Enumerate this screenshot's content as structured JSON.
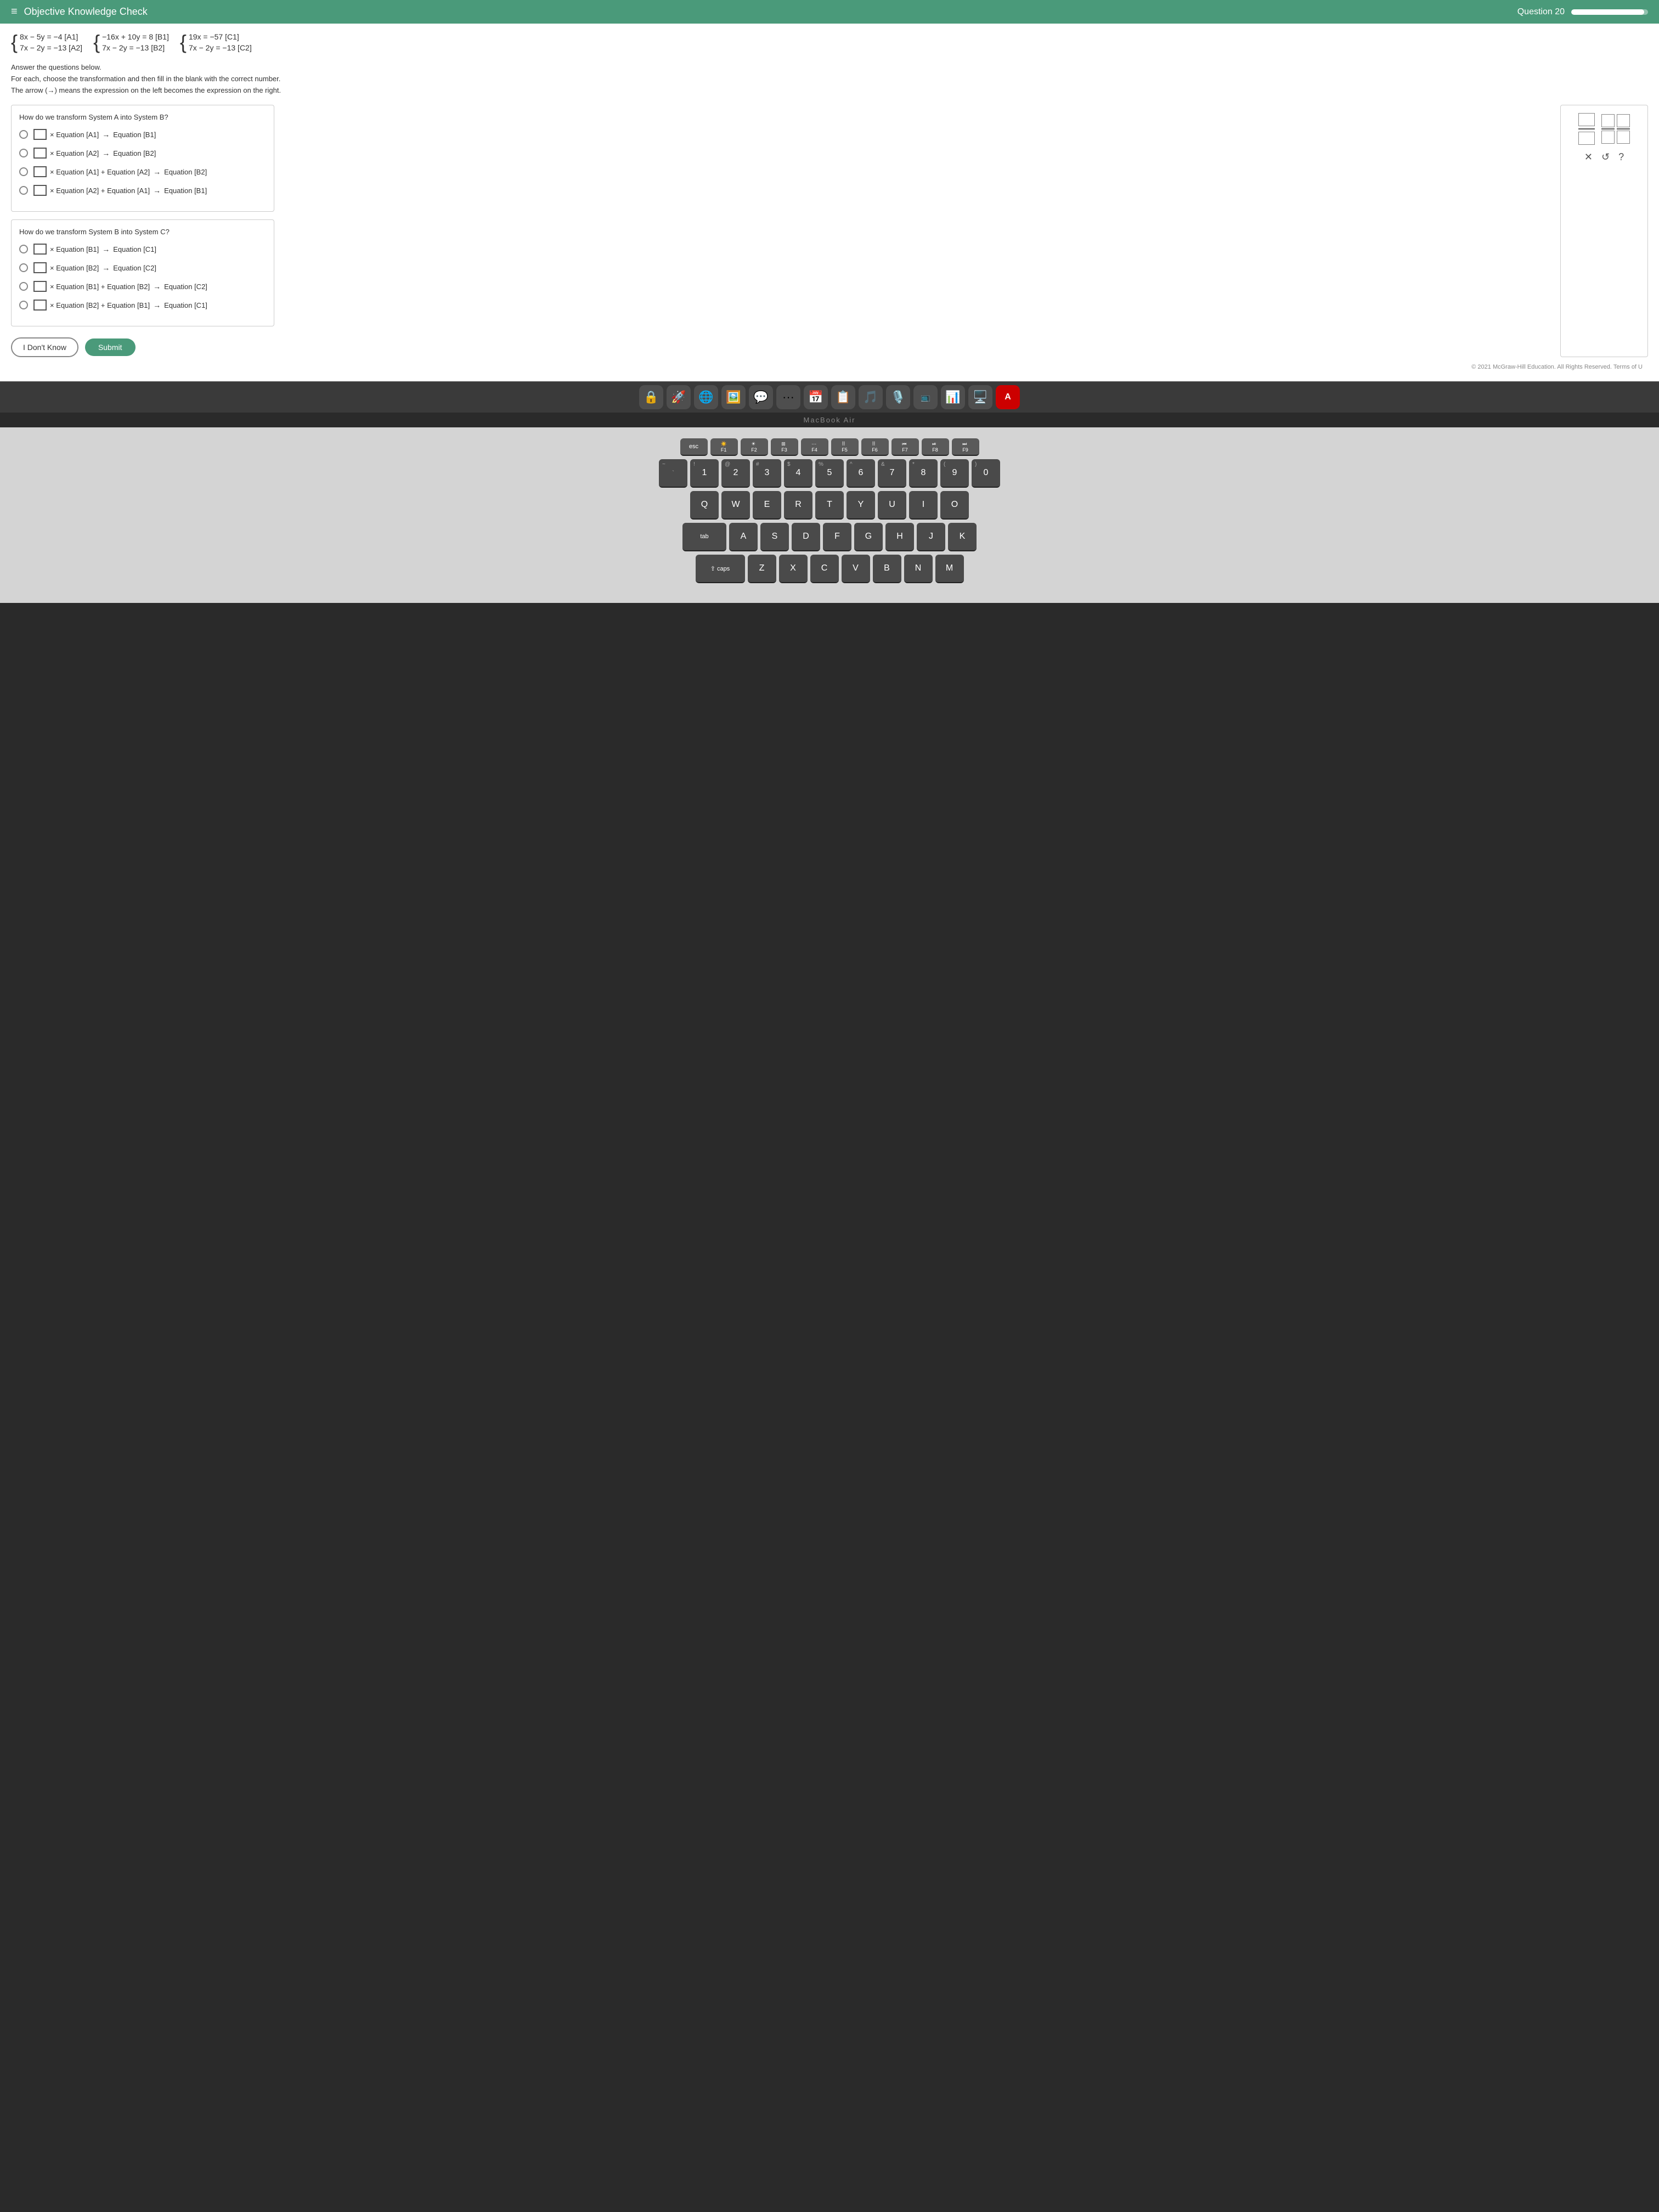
{
  "header": {
    "title": "Objective Knowledge Check",
    "question_label": "Question 20",
    "hamburger": "≡"
  },
  "equations": {
    "system_a": {
      "eq1": "8x − 5y = −4 [A1]",
      "eq2": "7x − 2y = −13 [A2]"
    },
    "system_b": {
      "eq1": "−16x + 10y = 8 [B1]",
      "eq2": "7x − 2y = −13 [B2]"
    },
    "system_c": {
      "eq1": "19x = −57 [C1]",
      "eq2": "7x − 2y = −13 [C2]"
    }
  },
  "instructions": {
    "line1": "Answer the questions below.",
    "line2": "For each, choose the transformation and then fill in the blank with the correct number.",
    "line3": "The arrow (→) means the expression on the left becomes the expression on the right."
  },
  "question1": {
    "title": "How do we transform System A into System B?",
    "options": [
      "□ × Equation [A1] → Equation [B1]",
      "□ × Equation [A2] → Equation [B2]",
      "□ × Equation [A1] + Equation [A2] → Equation [B2]",
      "□ × Equation [A2] + Equation [A1] → Equation [B1]"
    ]
  },
  "question2": {
    "title": "How do we transform System B into System C?",
    "options": [
      "□ × Equation [B1] → Equation [C1]",
      "□ × Equation [B2] → Equation [C2]",
      "□ × Equation [B1] + Equation [B2] → Equation [C2]",
      "□ × Equation [B2] + Equation [B1] → Equation [C1]"
    ]
  },
  "buttons": {
    "dont_know": "I Don't Know",
    "submit": "Submit"
  },
  "copyright": "© 2021 McGraw-Hill Education. All Rights Reserved.   Terms of U",
  "macbook_label": "MacBook Air",
  "dock": {
    "items": [
      "🔒",
      "🚀",
      "🌐",
      "🖼️",
      "💬",
      "…",
      "🗓️",
      "📸",
      "🎵",
      "📺",
      "🏦",
      "📊",
      "🖥️",
      "A"
    ]
  },
  "keyboard": {
    "fn_row": [
      "esc",
      "F1",
      "F2",
      "F3",
      "F4",
      "F5",
      "F6",
      "F7",
      "F8",
      "F9"
    ],
    "num_row": [
      "~",
      "!1",
      "@2",
      "#3",
      "$4",
      "%5",
      "^6",
      "&7",
      "*8",
      "(9",
      ")0"
    ],
    "q_row": [
      "Q",
      "W",
      "E",
      "R",
      "T",
      "Y",
      "U",
      "I",
      "O"
    ],
    "a_row": [
      "tab",
      "A",
      "S",
      "D",
      "F",
      "G",
      "H",
      "J",
      "K"
    ],
    "z_row": [
      "caps",
      "Z",
      "X",
      "C",
      "V",
      "B",
      "N",
      "M"
    ]
  }
}
